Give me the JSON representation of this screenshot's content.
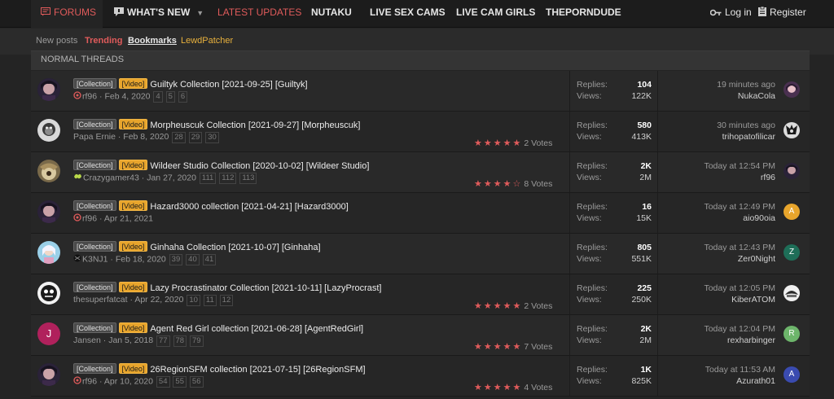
{
  "nav": {
    "forums": "FORUMS",
    "whats_new": "WHAT'S NEW",
    "latest_updates": "LATEST UPDATES",
    "nutaku": "NUTAKU",
    "live_sex_cams": "LIVE SEX CAMS",
    "live_cam_girls": "LIVE CAM GIRLS",
    "theporndude": "THEPORNDUDE",
    "login": "Log in",
    "register": "Register"
  },
  "subnav": {
    "new_posts": "New posts",
    "trending": "Trending",
    "bookmarks": "Bookmarks",
    "lewdpatcher": "LewdPatcher"
  },
  "section_title": "NORMAL THREADS",
  "labels": {
    "replies": "Replies:",
    "views": "Views:",
    "prefix_collection": "[Collection]",
    "prefix_video": "[Video]"
  },
  "threads": [
    {
      "title": "Guiltyk Collection [2021-09-25] [Guiltyk]",
      "author": "rf96",
      "date": "Feb 4, 2020",
      "pages": [
        "4",
        "5",
        "6"
      ],
      "rating": 0,
      "votes": "",
      "replies": "104",
      "views": "122K",
      "last_time": "19 minutes ago",
      "last_user": "NukaCola",
      "avatar": "a1",
      "last_avatar": "l1"
    },
    {
      "title": "Morpheuscuk Collection [2021-09-27] [Morpheuscuk]",
      "author": "Papa Ernie",
      "date": "Feb 8, 2020",
      "pages": [
        "28",
        "29",
        "30"
      ],
      "rating": 5,
      "votes": "2 Votes",
      "replies": "580",
      "views": "413K",
      "last_time": "30 minutes ago",
      "last_user": "trihopatofilicar",
      "avatar": "a2",
      "last_avatar": "l2"
    },
    {
      "title": "Wildeer Studio Collection [2020-10-02] [Wildeer Studio]",
      "author": "Crazygamer43",
      "date": "Jan 27, 2020",
      "pages": [
        "111",
        "112",
        "113"
      ],
      "rating": 4,
      "votes": "8 Votes",
      "replies": "2K",
      "views": "2M",
      "last_time": "Today at 12:54 PM",
      "last_user": "rf96",
      "avatar": "a3",
      "last_avatar": "l3"
    },
    {
      "title": "Hazard3000 collection [2021-04-21] [Hazard3000]",
      "author": "rf96",
      "date": "Apr 21, 2021",
      "pages": [],
      "rating": 0,
      "votes": "",
      "replies": "16",
      "views": "15K",
      "last_time": "Today at 12:49 PM",
      "last_user": "aio90oia",
      "avatar": "a1",
      "last_avatar": "A"
    },
    {
      "title": "Ginhaha Collection [2021-10-07] [Ginhaha]",
      "author": "K3NJ1",
      "date": "Feb 18, 2020",
      "pages": [
        "39",
        "40",
        "41"
      ],
      "rating": 0,
      "votes": "",
      "replies": "805",
      "views": "551K",
      "last_time": "Today at 12:43 PM",
      "last_user": "Zer0Night",
      "avatar": "a5",
      "last_avatar": "Z"
    },
    {
      "title": "Lazy Procrastinator Collection [2021-10-11] [LazyProcrast]",
      "author": "thesuperfatcat",
      "date": "Apr 22, 2020",
      "pages": [
        "10",
        "11",
        "12"
      ],
      "rating": 5,
      "votes": "2 Votes",
      "replies": "225",
      "views": "250K",
      "last_time": "Today at 12:05 PM",
      "last_user": "KiberATOM",
      "avatar": "a6",
      "last_avatar": "l6"
    },
    {
      "title": "Agent Red Girl collection [2021-06-28] [AgentRedGirl]",
      "author": "Jansen",
      "date": "Jan 5, 2018",
      "pages": [
        "77",
        "78",
        "79"
      ],
      "rating": 5,
      "votes": "7 Votes",
      "replies": "2K",
      "views": "2M",
      "last_time": "Today at 12:04 PM",
      "last_user": "rexharbinger",
      "avatar": "J",
      "last_avatar": "R"
    },
    {
      "title": "26RegionSFM collection [2021-07-15] [26RegionSFM]",
      "author": "rf96",
      "date": "Apr 10, 2020",
      "pages": [
        "54",
        "55",
        "56"
      ],
      "rating": 5,
      "votes": "4 Votes",
      "replies": "1K",
      "views": "825K",
      "last_time": "Today at 11:53 AM",
      "last_user": "Azurath01",
      "avatar": "a1",
      "last_avatar": "A"
    }
  ],
  "colors": {
    "accent_red": "#e05b5b",
    "prefix_video": "#e8a52c",
    "lewdpatcher": "#e8b13d",
    "letter_avatars": {
      "A": "#e8a52c",
      "Z": "#1e6e58",
      "J": "#b0215c",
      "R": "#6db56b",
      "A2": "#3a4bb0"
    }
  }
}
